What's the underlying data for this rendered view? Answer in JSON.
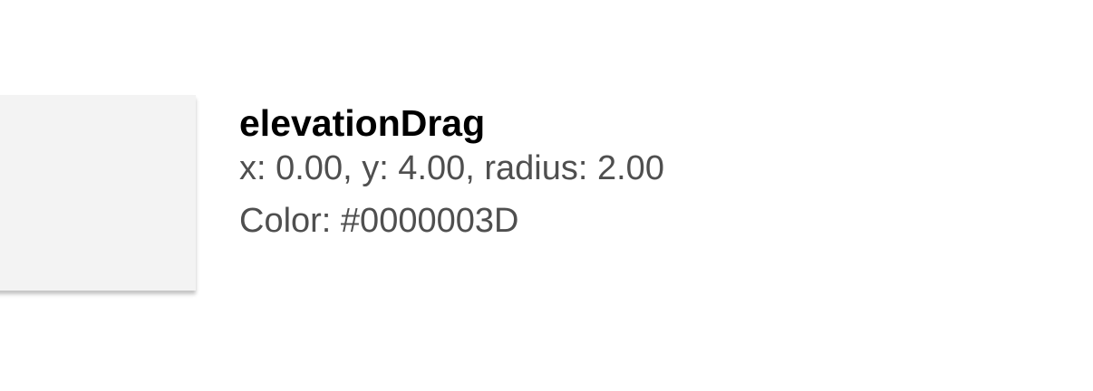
{
  "token": {
    "name": "elevationDrag",
    "offset_line": "x: 0.00, y: 4.00, radius: 2.00",
    "color_line": "Color: #0000003D",
    "shadow": {
      "x": 0.0,
      "y": 4.0,
      "radius": 2.0,
      "color": "#0000003D"
    },
    "swatch_color": "#f3f3f3"
  }
}
